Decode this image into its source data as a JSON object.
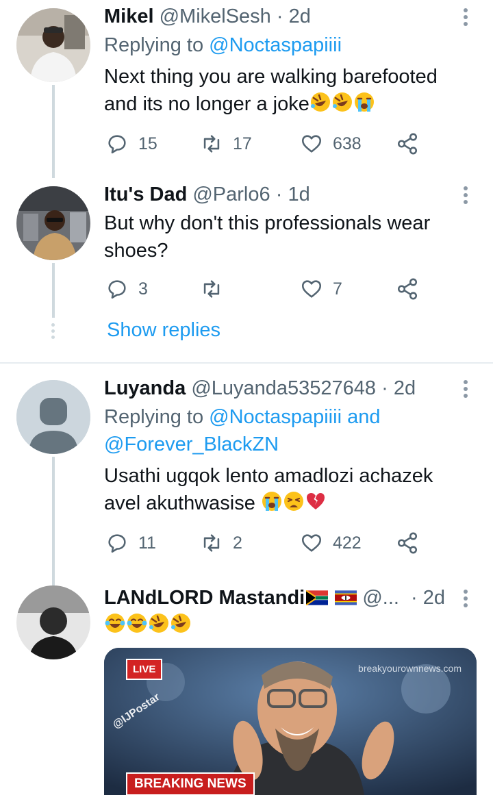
{
  "tweets": [
    {
      "name": "Mikel",
      "handle": "@MikelSesh",
      "dot": "·",
      "time": "2d",
      "reply_prefix": "Replying to",
      "reply_mentions": "@Noctaspapiiii",
      "text_line1": "Next thing you are walking barefooted",
      "text_line2": "and its no longer a joke",
      "emojis": [
        "rolling-on-floor-laughing",
        "rolling-on-floor-laughing",
        "loudly-crying"
      ],
      "replies": "15",
      "retweets": "17",
      "likes": "638"
    },
    {
      "name": "Itu's Dad",
      "handle": "@Parlo6",
      "dot": "·",
      "time": "1d",
      "text_line1": "But why don't this professionals wear",
      "text_line2": "shoes?",
      "replies": "3",
      "retweets": "",
      "likes": "7"
    },
    {
      "name": "Luyanda",
      "handle": "@Luyanda53527648",
      "dot": "·",
      "time": "2d",
      "reply_prefix": "Replying to",
      "reply_mentions_line1": "@Noctaspapiiii and",
      "reply_mentions_line2": "@Forever_BlackZN",
      "text_line1": "Usathi ugqok lento amadlozi achazek",
      "text_line2": "avel akuthwasise",
      "emojis": [
        "loudly-crying",
        "weary",
        "broken-heart"
      ],
      "replies": "11",
      "retweets": "2",
      "likes": "422"
    },
    {
      "name": "LANdLORD Mastandi",
      "handle": "@...",
      "dot": "·",
      "time": "2d",
      "emojis": [
        "tears-of-joy",
        "tears-of-joy",
        "rolling-on-floor-laughing",
        "rolling-on-floor-laughing"
      ],
      "media": {
        "live_badge": "LIVE",
        "site_watermark": "breakyourownnews.com",
        "stamp": "@IJPostar",
        "banner": "BREAKING NEWS"
      }
    }
  ],
  "show_replies": "Show replies",
  "colors": {
    "accent": "#1d9bf0",
    "secondary_text": "#536471",
    "thread_line": "#cfd9de",
    "live_red": "#d32323"
  }
}
